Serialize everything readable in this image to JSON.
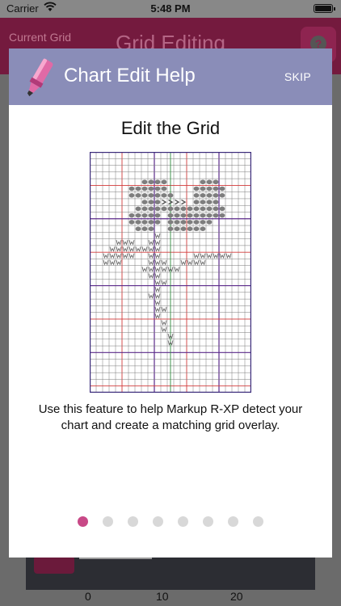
{
  "status_bar": {
    "carrier": "Carrier",
    "time": "5:48 PM"
  },
  "app_header": {
    "back_label": "Current Grid",
    "title": "Grid Editing",
    "help_label": "?"
  },
  "ruler": {
    "ticks": [
      "0",
      "10",
      "20"
    ]
  },
  "modal": {
    "title": "Chart Edit Help",
    "skip_label": "SKIP",
    "heading": "Edit the Grid",
    "description": "Use this feature to help Markup R-XP detect your chart and create a matching grid overlay.",
    "page_count": 8,
    "active_page": 0
  },
  "colors": {
    "modal_header": "#8a8db8",
    "dot_active": "#c84987",
    "dot_inactive": "#d8d8d8",
    "app_header": "#741a3e",
    "marker_pink": "#e06aa6"
  },
  "grid_chart": {
    "cols": 25,
    "rows": 36,
    "stitches": [
      {
        "symbol": "oval",
        "row": 4,
        "cols": [
          8,
          9,
          10,
          11,
          17,
          18,
          19
        ]
      },
      {
        "symbol": "oval",
        "row": 5,
        "cols": [
          6,
          7,
          8,
          9,
          10,
          11,
          16,
          17,
          18,
          19,
          20
        ]
      },
      {
        "symbol": "oval",
        "row": 6,
        "cols": [
          6,
          7,
          8,
          9,
          10,
          11,
          12,
          16,
          17,
          18,
          19,
          20
        ]
      },
      {
        "symbol": "chevron",
        "row": 7,
        "cols": [
          11,
          12,
          13,
          14
        ]
      },
      {
        "symbol": "oval",
        "row": 7,
        "cols": [
          8,
          9,
          10,
          16,
          17,
          18,
          19
        ]
      },
      {
        "symbol": "oval",
        "row": 8,
        "cols": [
          7,
          8,
          9,
          10,
          11,
          12,
          13,
          14,
          15,
          16,
          17,
          18,
          19,
          20
        ]
      },
      {
        "symbol": "oval",
        "row": 9,
        "cols": [
          6,
          7,
          8,
          9,
          10,
          12,
          13,
          14,
          15,
          16,
          17,
          18,
          19,
          20
        ]
      },
      {
        "symbol": "oval",
        "row": 10,
        "cols": [
          6,
          7,
          8,
          9,
          10,
          12,
          13,
          14,
          15,
          16,
          17,
          18
        ]
      },
      {
        "symbol": "oval",
        "row": 11,
        "cols": [
          7,
          8,
          9,
          12,
          13,
          14,
          15,
          16,
          17
        ]
      },
      {
        "symbol": "w",
        "row": 12,
        "cols": [
          10
        ]
      },
      {
        "symbol": "w",
        "row": 13,
        "cols": [
          4,
          5,
          6,
          9,
          10
        ]
      },
      {
        "symbol": "w",
        "row": 14,
        "cols": [
          3,
          4,
          5,
          6,
          7,
          8,
          9,
          10
        ]
      },
      {
        "symbol": "w",
        "row": 15,
        "cols": [
          2,
          3,
          4,
          5,
          6,
          9,
          10,
          16,
          17,
          18,
          19,
          20,
          21
        ]
      },
      {
        "symbol": "w",
        "row": 16,
        "cols": [
          2,
          3,
          4,
          9,
          10,
          11,
          14,
          15,
          16,
          17
        ]
      },
      {
        "symbol": "w",
        "row": 17,
        "cols": [
          8,
          9,
          10,
          11,
          12,
          13
        ]
      },
      {
        "symbol": "w",
        "row": 18,
        "cols": [
          9,
          10
        ]
      },
      {
        "symbol": "w",
        "row": 19,
        "cols": [
          10,
          11
        ]
      },
      {
        "symbol": "w",
        "row": 20,
        "cols": [
          10
        ]
      },
      {
        "symbol": "w",
        "row": 21,
        "cols": [
          9,
          10
        ]
      },
      {
        "symbol": "w",
        "row": 22,
        "cols": [
          10
        ]
      },
      {
        "symbol": "w",
        "row": 23,
        "cols": [
          10,
          11
        ]
      },
      {
        "symbol": "w",
        "row": 24,
        "cols": [
          10
        ]
      },
      {
        "symbol": "w",
        "row": 25,
        "cols": [
          11
        ]
      },
      {
        "symbol": "w",
        "row": 26,
        "cols": [
          11
        ]
      },
      {
        "symbol": "w",
        "row": 27,
        "cols": [
          12
        ]
      },
      {
        "symbol": "w",
        "row": 28,
        "cols": [
          12
        ]
      }
    ]
  }
}
